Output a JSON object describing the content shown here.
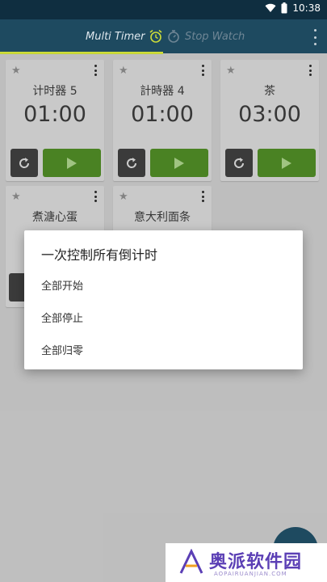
{
  "status_bar": {
    "time": "10:38"
  },
  "tabs": [
    {
      "label": "Multi Timer",
      "icon": "alarm-clock-icon",
      "active": true
    },
    {
      "label": "Stop Watch",
      "icon": "stopwatch-icon",
      "active": false
    }
  ],
  "timers": [
    {
      "name": "计时器 5",
      "time": "01:00"
    },
    {
      "name": "計時器 4",
      "time": "01:00"
    },
    {
      "name": "茶",
      "time": "03:00"
    },
    {
      "name": "煮溏心蛋"
    },
    {
      "name": "意大利面条"
    }
  ],
  "dialog": {
    "title": "一次控制所有倒计时",
    "items": [
      "全部开始",
      "全部停止",
      "全部归零"
    ]
  },
  "watermark": {
    "brand": "奥派软件园",
    "url": "AOPAIRUANJIAN.COM"
  },
  "colors": {
    "app_bar": "#1e4a60",
    "status_bar": "#0f2e40",
    "tab_indicator": "#cddc39",
    "play_button": "#4f8a25",
    "reset_button": "#3f3f3f",
    "card": "#d4d4d4",
    "background": "#c9c9c9"
  }
}
